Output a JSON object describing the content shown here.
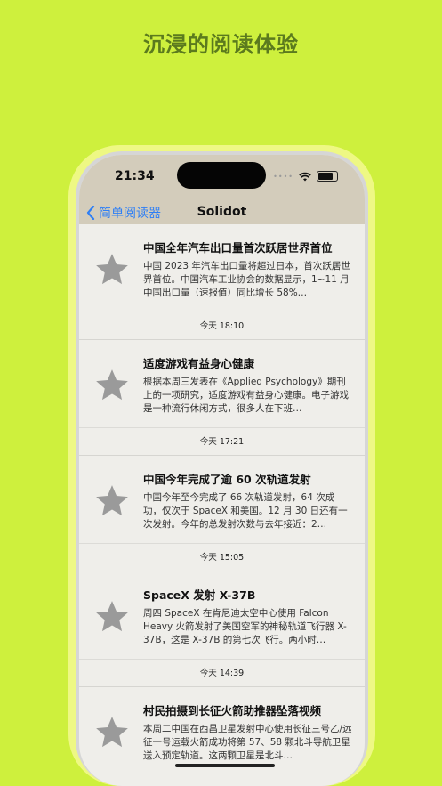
{
  "headline": "沉浸的阅读体验",
  "status_bar": {
    "time": "21:34"
  },
  "nav": {
    "back_label": "简单阅读器",
    "title": "Solidot"
  },
  "articles": [
    {
      "title": "中国全年汽车出口量首次跃居世界首位",
      "snippet": "中国 2023 年汽车出口量将超过日本，首次跃居世界首位。中国汽车工业协会的数据显示，1~11 月中国出口量（速报值）同比增长 58%…",
      "time": "今天 18:10"
    },
    {
      "title": "适度游戏有益身心健康",
      "snippet": "根据本周三发表在《Applied Psychology》期刊上的一项研究，适度游戏有益身心健康。电子游戏是一种流行休闲方式，很多人在下班…",
      "time": "今天 17:21"
    },
    {
      "title": "中国今年完成了逾 60 次轨道发射",
      "snippet": "中国今年至今完成了 66 次轨道发射，64 次成功，仅次于 SpaceX 和美国。12 月 30 日还有一次发射。今年的总发射次数与去年接近：2…",
      "time": "今天 15:05"
    },
    {
      "title": "SpaceX 发射 X-37B",
      "snippet": "周四 SpaceX 在肯尼迪太空中心使用 Falcon Heavy 火箭发射了美国空军的神秘轨道飞行器 X-37B，这是 X-37B 的第七次飞行。两小时…",
      "time": "今天 14:39"
    },
    {
      "title": "村民拍摄到长征火箭助推器坠落视频",
      "snippet": "本周二中国在西昌卫星发射中心使用长征三号乙/远征一号运载火箭成功将第 57、58 颗北斗导航卫星送入预定轨道。这两颗卫星是北斗…",
      "time": ""
    }
  ],
  "colors": {
    "background": "#cef03d",
    "accent": "#2f7ff5",
    "star": "#9a9a9a",
    "nav_bar": "#d3ccbb"
  },
  "icons": {
    "star": "star-icon",
    "back": "chevron-left-icon",
    "wifi": "wifi-icon",
    "battery": "battery-icon"
  }
}
